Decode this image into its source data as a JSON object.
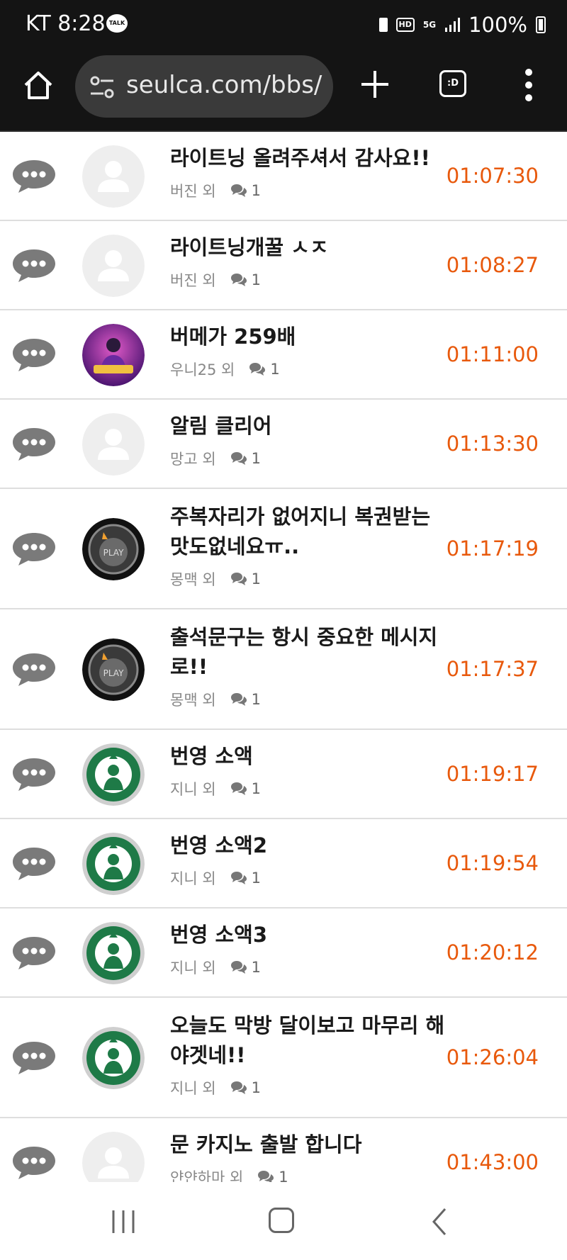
{
  "status_bar": {
    "carrier_time": "KT 8:28",
    "talk_badge": "TALK",
    "hd_label": "HD",
    "network_label": "5G",
    "battery_percent": "100%"
  },
  "browser": {
    "url": "seulca.com/bbs/",
    "tabs_label": ":D"
  },
  "posts": [
    {
      "title": "라이트닝 올려주셔서 감사요!!",
      "author": "버진 외",
      "comments": "1",
      "time": "01:07:30",
      "avatar": "default",
      "tall": false
    },
    {
      "title": "라이트닝개꿀 ㅅㅈ",
      "author": "버진 외",
      "comments": "1",
      "time": "01:08:27",
      "avatar": "default",
      "tall": false
    },
    {
      "title": "버메가 259배",
      "author": "우니25 외",
      "comments": "1",
      "time": "01:11:00",
      "avatar": "game-character",
      "tall": false
    },
    {
      "title": "알림 클리어",
      "author": "망고 외",
      "comments": "1",
      "time": "01:13:30",
      "avatar": "default",
      "tall": false
    },
    {
      "title": "주복자리가 없어지니 복권받는 맛도없네요ㅠ..",
      "author": "몽맥 외",
      "comments": "1",
      "time": "01:17:19",
      "avatar": "play-badge",
      "tall": true
    },
    {
      "title": "출석문구는 항시 중요한 메시지로!!",
      "author": "몽맥 외",
      "comments": "1",
      "time": "01:17:37",
      "avatar": "play-badge",
      "tall": true
    },
    {
      "title": "번영 소액",
      "author": "지니 외",
      "comments": "1",
      "time": "01:19:17",
      "avatar": "starbucks",
      "tall": false
    },
    {
      "title": "번영 소액2",
      "author": "지니 외",
      "comments": "1",
      "time": "01:19:54",
      "avatar": "starbucks",
      "tall": false
    },
    {
      "title": "번영 소액3",
      "author": "지니 외",
      "comments": "1",
      "time": "01:20:12",
      "avatar": "starbucks",
      "tall": false
    },
    {
      "title": "오늘도 막방 달이보고 마무리 해야겟네!!",
      "author": "지니 외",
      "comments": "1",
      "time": "01:26:04",
      "avatar": "starbucks",
      "tall": true
    },
    {
      "title": "문 카지노 출발 합니다",
      "author": "얀얀하마 외",
      "comments": "1",
      "time": "01:43:00",
      "avatar": "default",
      "tall": false
    }
  ],
  "avatar_badge_text": "PLAY",
  "colors": {
    "time_accent": "#e8590c",
    "header_bg": "#141414",
    "chat_icon": "#777777"
  }
}
